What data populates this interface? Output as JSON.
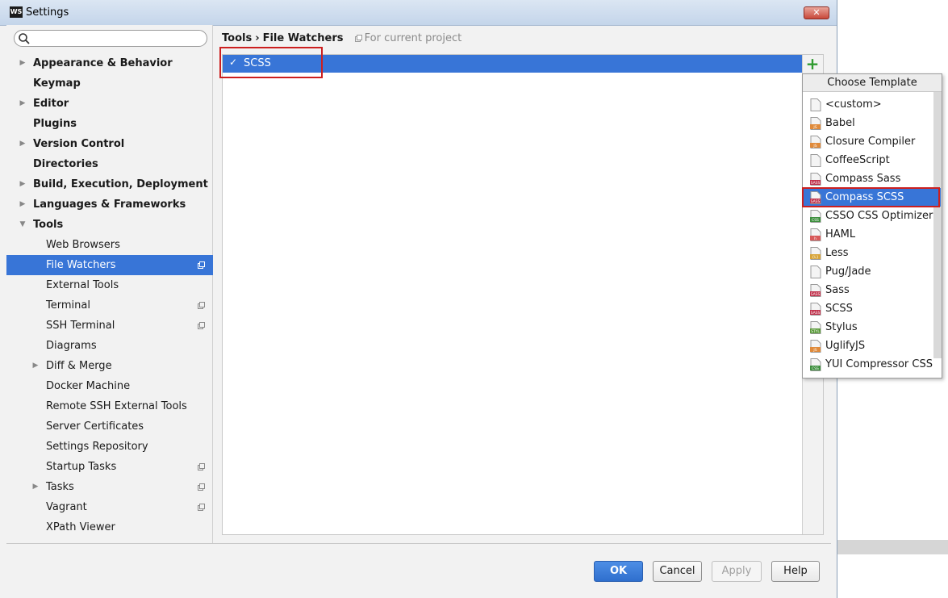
{
  "window": {
    "title": "Settings",
    "app_icon_text": "WS",
    "close_glyph": "✕"
  },
  "search": {
    "placeholder": ""
  },
  "sidebar": {
    "items": [
      {
        "label": "Appearance & Behavior",
        "level": 0,
        "arrow": "▶",
        "project": false
      },
      {
        "label": "Keymap",
        "level": 0,
        "arrow": "",
        "project": false
      },
      {
        "label": "Editor",
        "level": 0,
        "arrow": "▶",
        "project": false
      },
      {
        "label": "Plugins",
        "level": 0,
        "arrow": "",
        "project": false
      },
      {
        "label": "Version Control",
        "level": 0,
        "arrow": "▶",
        "project": false
      },
      {
        "label": "Directories",
        "level": 0,
        "arrow": "",
        "project": false
      },
      {
        "label": "Build, Execution, Deployment",
        "level": 0,
        "arrow": "▶",
        "project": false
      },
      {
        "label": "Languages & Frameworks",
        "level": 0,
        "arrow": "▶",
        "project": false
      },
      {
        "label": "Tools",
        "level": 0,
        "arrow": "▼",
        "project": false
      },
      {
        "label": "Web Browsers",
        "level": 1,
        "arrow": "",
        "project": false
      },
      {
        "label": "File Watchers",
        "level": 1,
        "arrow": "",
        "project": true,
        "selected": true
      },
      {
        "label": "External Tools",
        "level": 1,
        "arrow": "",
        "project": false
      },
      {
        "label": "Terminal",
        "level": 1,
        "arrow": "",
        "project": true
      },
      {
        "label": "SSH Terminal",
        "level": 1,
        "arrow": "",
        "project": true
      },
      {
        "label": "Diagrams",
        "level": 1,
        "arrow": "",
        "project": false
      },
      {
        "label": "Diff & Merge",
        "level": 1,
        "arrow": "▶",
        "project": false
      },
      {
        "label": "Docker Machine",
        "level": 1,
        "arrow": "",
        "project": false
      },
      {
        "label": "Remote SSH External Tools",
        "level": 1,
        "arrow": "",
        "project": false
      },
      {
        "label": "Server Certificates",
        "level": 1,
        "arrow": "",
        "project": false
      },
      {
        "label": "Settings Repository",
        "level": 1,
        "arrow": "",
        "project": false
      },
      {
        "label": "Startup Tasks",
        "level": 1,
        "arrow": "",
        "project": true
      },
      {
        "label": "Tasks",
        "level": 1,
        "arrow": "▶",
        "project": true
      },
      {
        "label": "Vagrant",
        "level": 1,
        "arrow": "",
        "project": true
      },
      {
        "label": "XPath Viewer",
        "level": 1,
        "arrow": "",
        "project": false
      }
    ]
  },
  "breadcrumb": {
    "parent": "Tools",
    "separator": "›",
    "current": "File Watchers",
    "scope": "For current project"
  },
  "watchers": [
    {
      "label": "SCSS",
      "enabled": true,
      "check_glyph": "✓"
    }
  ],
  "toolbar": {
    "add_glyph": "+"
  },
  "template_popup": {
    "title": "Choose Template",
    "items": [
      {
        "label": "<custom>",
        "icon": "file-icon",
        "badge": "",
        "badge_color": "#9a9a9a"
      },
      {
        "label": "Babel",
        "icon": "js-file-icon",
        "badge": "JS",
        "badge_color": "#e08a3a"
      },
      {
        "label": "Closure Compiler",
        "icon": "js-file-icon",
        "badge": "JS",
        "badge_color": "#e08a3a"
      },
      {
        "label": "CoffeeScript",
        "icon": "coffee-file-icon",
        "badge": "",
        "badge_color": "#5a4a3a"
      },
      {
        "label": "Compass Sass",
        "icon": "sass-file-icon",
        "badge": "SASS",
        "badge_color": "#c0304a"
      },
      {
        "label": "Compass SCSS",
        "icon": "sass-file-icon",
        "badge": "SASS",
        "badge_color": "#c0304a",
        "selected": true
      },
      {
        "label": "CSSO CSS Optimizer",
        "icon": "css-file-icon",
        "badge": "CSS",
        "badge_color": "#3e8f3e"
      },
      {
        "label": "HAML",
        "icon": "haml-file-icon",
        "badge": "h",
        "badge_color": "#d85a5a"
      },
      {
        "label": "Less",
        "icon": "less-file-icon",
        "badge": "{L}",
        "badge_color": "#d8a53a"
      },
      {
        "label": "Pug/Jade",
        "icon": "pug-icon",
        "badge": "",
        "badge_color": "#b07a4a"
      },
      {
        "label": "Sass",
        "icon": "sass-file-icon",
        "badge": "SASS",
        "badge_color": "#c0304a"
      },
      {
        "label": "SCSS",
        "icon": "sass-file-icon",
        "badge": "SASS",
        "badge_color": "#c0304a"
      },
      {
        "label": "Stylus",
        "icon": "stylus-file-icon",
        "badge": "STYL",
        "badge_color": "#5a9a3a"
      },
      {
        "label": "UglifyJS",
        "icon": "js-file-icon",
        "badge": "JS",
        "badge_color": "#e08a3a"
      },
      {
        "label": "YUI Compressor CSS",
        "icon": "css-file-icon",
        "badge": "CSS",
        "badge_color": "#3e8f3e"
      }
    ]
  },
  "buttons": {
    "ok": "OK",
    "cancel": "Cancel",
    "apply": "Apply",
    "help": "Help"
  },
  "colors": {
    "selection": "#3875d7",
    "highlight_box": "#cc1f1f",
    "add_green": "#2f9b2f"
  }
}
